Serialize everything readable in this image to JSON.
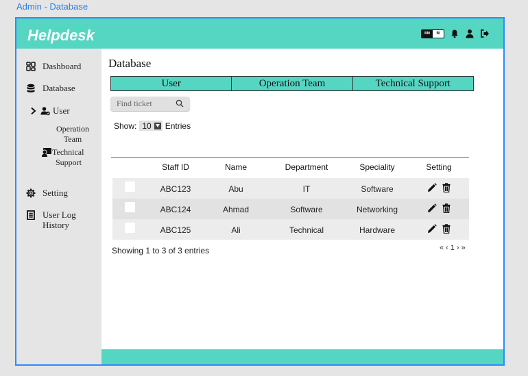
{
  "frame_label": "Admin - Database",
  "app": {
    "brand": "Helpdesk"
  },
  "header": {
    "lang_left": "BM",
    "lang_right": "BI"
  },
  "sidebar": {
    "dashboard": "Dashboard",
    "database": "Database",
    "user": "User",
    "operation_team_line1": "Operation",
    "operation_team_line2": "Team",
    "technical_line1": "Technical",
    "technical_line2": "Support",
    "setting": "Setting",
    "user_log_line1": "User Log",
    "user_log_line2": "History"
  },
  "main": {
    "title": "Database",
    "tabs": [
      "User",
      "Operation Team",
      "Technical Support"
    ],
    "search_placeholder": "Find ticket",
    "show_label": "Show:",
    "show_value": "10",
    "entries_label": "Entries",
    "columns": [
      "Staff ID",
      "Name",
      "Department",
      "Speciality",
      "Setting"
    ],
    "rows": [
      {
        "staff_id": "ABC123",
        "name": "Abu",
        "department": "IT",
        "speciality": "Software"
      },
      {
        "staff_id": "ABC124",
        "name": "Ahmad",
        "department": "Software",
        "speciality": "Networking"
      },
      {
        "staff_id": "ABC125",
        "name": "Ali",
        "department": "Technical",
        "speciality": "Hardware"
      }
    ],
    "showing_text": "Showing 1 to 3 of 3 entries",
    "pager": {
      "first": "«",
      "prev": "‹",
      "page": "1",
      "next": "›",
      "last": "»"
    }
  },
  "colors": {
    "accent": "#55d6c2",
    "frame_border": "#2b8cff",
    "sidebar_bg": "#e5e5e5"
  },
  "icons": [
    "dashboard-icon",
    "database-icon",
    "chevron-right-icon",
    "user-check-icon",
    "technical-support-icon",
    "gear-icon",
    "document-icon",
    "bell-icon",
    "user-icon",
    "logout-icon",
    "search-icon",
    "edit-icon",
    "trash-icon"
  ]
}
